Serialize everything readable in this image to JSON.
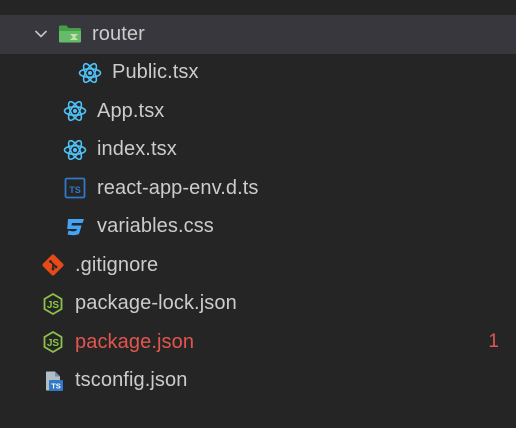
{
  "explorer": {
    "items": [
      {
        "label": "router",
        "icon": "folder-router-icon",
        "kind": "folder",
        "expanded": true
      },
      {
        "label": "Public.tsx",
        "icon": "react-icon",
        "kind": "file"
      },
      {
        "label": "App.tsx",
        "icon": "react-icon",
        "kind": "file"
      },
      {
        "label": "index.tsx",
        "icon": "react-icon",
        "kind": "file"
      },
      {
        "label": "react-app-env.d.ts",
        "icon": "typescript-icon",
        "kind": "file"
      },
      {
        "label": "variables.css",
        "icon": "css-icon",
        "kind": "file"
      },
      {
        "label": ".gitignore",
        "icon": "git-icon",
        "kind": "file"
      },
      {
        "label": "package-lock.json",
        "icon": "node-icon",
        "kind": "file"
      },
      {
        "label": "package.json",
        "icon": "node-icon",
        "kind": "file",
        "modified": true,
        "badge": "1"
      },
      {
        "label": "tsconfig.json",
        "icon": "tsconfig-icon",
        "kind": "file"
      }
    ]
  },
  "colors": {
    "background": "#252526",
    "selected": "#37373d",
    "text": "#cccccc",
    "modified": "#e2564e",
    "react": "#4fc3f7",
    "typescript": "#3178c6",
    "css": "#42a5f5",
    "git": "#e64a19",
    "node": "#8bc34a",
    "folder": "#4caf50"
  }
}
